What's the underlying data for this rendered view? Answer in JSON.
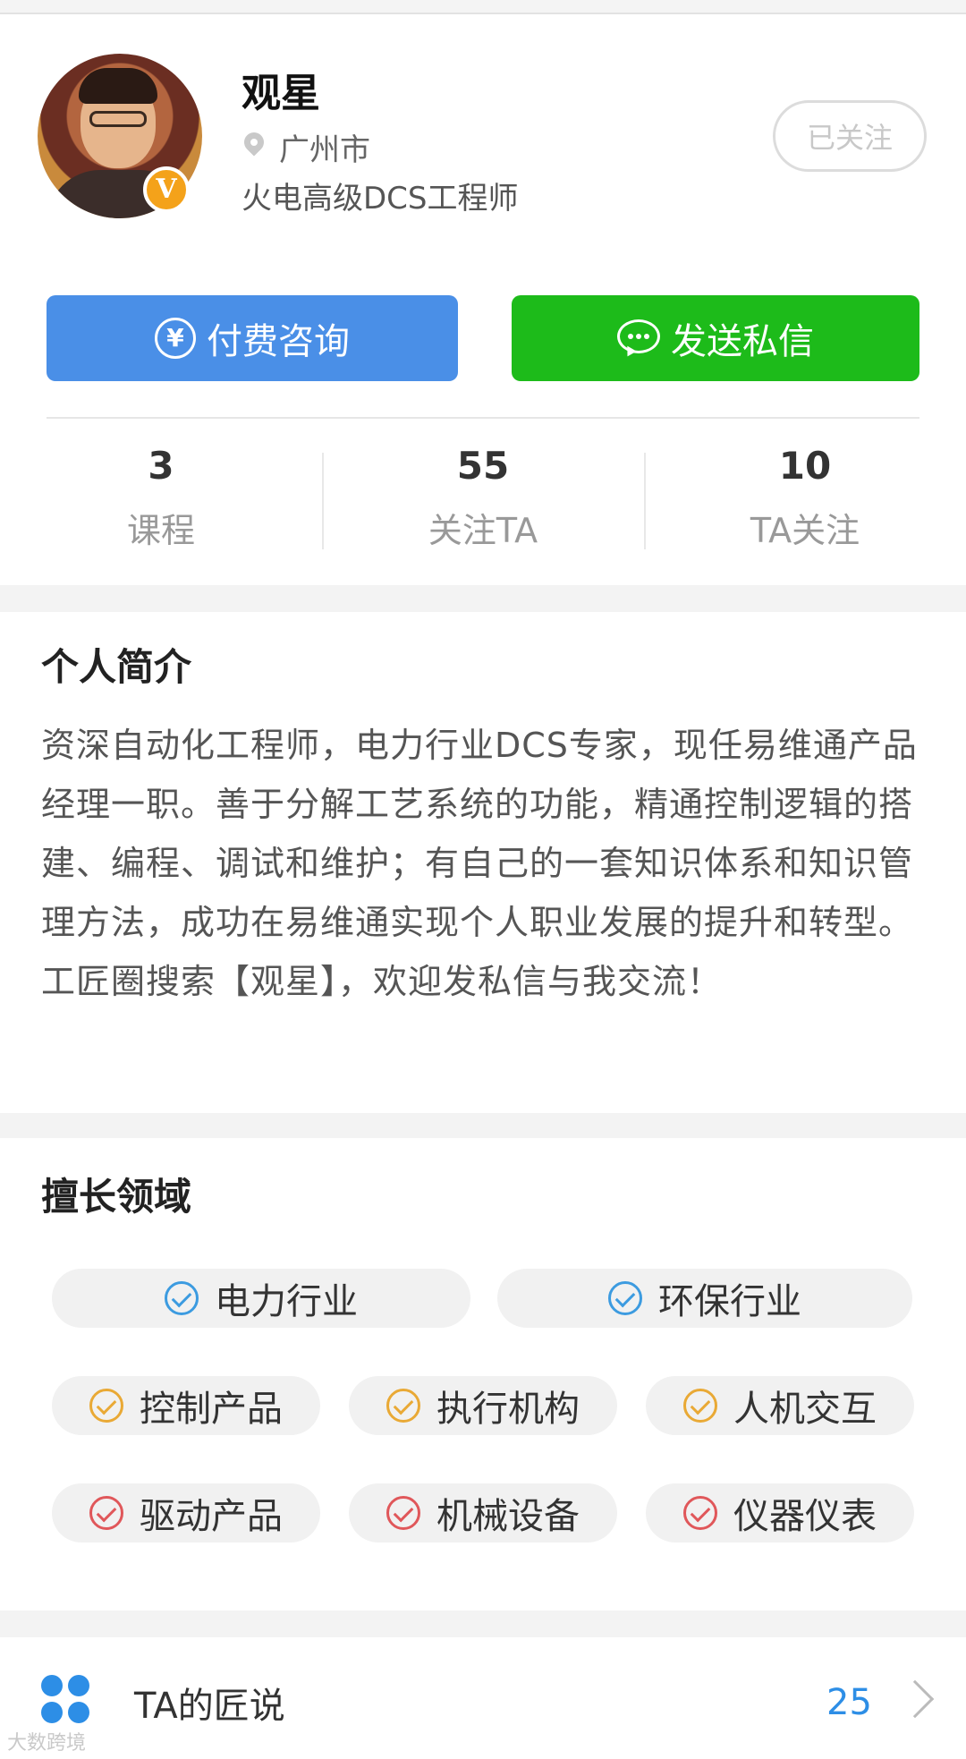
{
  "profile": {
    "name": "观星",
    "location": "广州市",
    "title": "火电高级DCS工程师",
    "badge": "V",
    "follow_button": "已关注"
  },
  "actions": {
    "pay_label": "付费咨询",
    "pay_icon": "¥",
    "message_label": "发送私信"
  },
  "stats": [
    {
      "value": "3",
      "label": "课程"
    },
    {
      "value": "55",
      "label": "关注TA"
    },
    {
      "value": "10",
      "label": "TA关注"
    }
  ],
  "bio": {
    "heading": "个人简介",
    "text": "资深自动化工程师，电力行业DCS专家，现任易维通产品经理一职。善于分解工艺系统的功能，精通控制逻辑的搭建、编程、调试和维护；有自己的一套知识体系和知识管理方法，成功在易维通实现个人职业发展的提升和转型。工匠圈搜索【观星】，欢迎发私信与我交流！"
  },
  "expertise": {
    "heading": "擅长领域",
    "tags": [
      {
        "label": "电力行业",
        "color": "#3c9be0"
      },
      {
        "label": "环保行业",
        "color": "#3c9be0"
      },
      {
        "label": "控制产品",
        "color": "#e9a935"
      },
      {
        "label": "执行机构",
        "color": "#e9a935"
      },
      {
        "label": "人机交互",
        "color": "#e9a935"
      },
      {
        "label": "驱动产品",
        "color": "#e0575a"
      },
      {
        "label": "机械设备",
        "color": "#e0575a"
      },
      {
        "label": "仪器仪表",
        "color": "#e0575a"
      }
    ]
  },
  "footer_row": {
    "label": "TA的匠说",
    "count": "25"
  },
  "watermark": "大数跨境"
}
